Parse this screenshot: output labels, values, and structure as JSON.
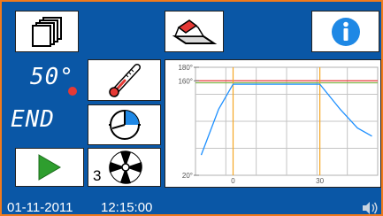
{
  "header": {
    "programs_icon": "stacked-documents-icon",
    "erase_icon": "eraser-icon",
    "info_icon": "info-icon"
  },
  "left_panel": {
    "temperature": "50°",
    "status": "END",
    "fan_level": "3",
    "thermometer_icon": "thermometer-icon",
    "timer_icon": "timer-icon",
    "play_icon": "play-icon",
    "fan_icon": "fan-icon"
  },
  "status_bar": {
    "date": "01-11-2011",
    "time": "12:15:00",
    "speaker_icon": "speaker-icon"
  },
  "chart_data": {
    "type": "line",
    "y_tick_labels": [
      "180°",
      "160°",
      "20°"
    ],
    "x_tick_labels": [
      "0",
      "30"
    ],
    "yticks": [
      180,
      160,
      20
    ],
    "xticks": [
      0,
      30
    ],
    "ylim": [
      20,
      180
    ],
    "xlim": [
      -13,
      50
    ],
    "grid": true,
    "reference_lines": [
      {
        "name": "",
        "value": 160,
        "color": "#e53935"
      },
      {
        "name": "",
        "value": 157,
        "color": "#7cb342"
      }
    ],
    "markers_x": [
      0,
      30
    ],
    "marker_color": "#f5a623",
    "series": [
      {
        "color": "#1e90ff",
        "x": [
          -11,
          -5,
          0,
          30,
          37,
          43,
          48
        ],
        "y": [
          50,
          118,
          155,
          155,
          118,
          90,
          78
        ]
      }
    ]
  }
}
